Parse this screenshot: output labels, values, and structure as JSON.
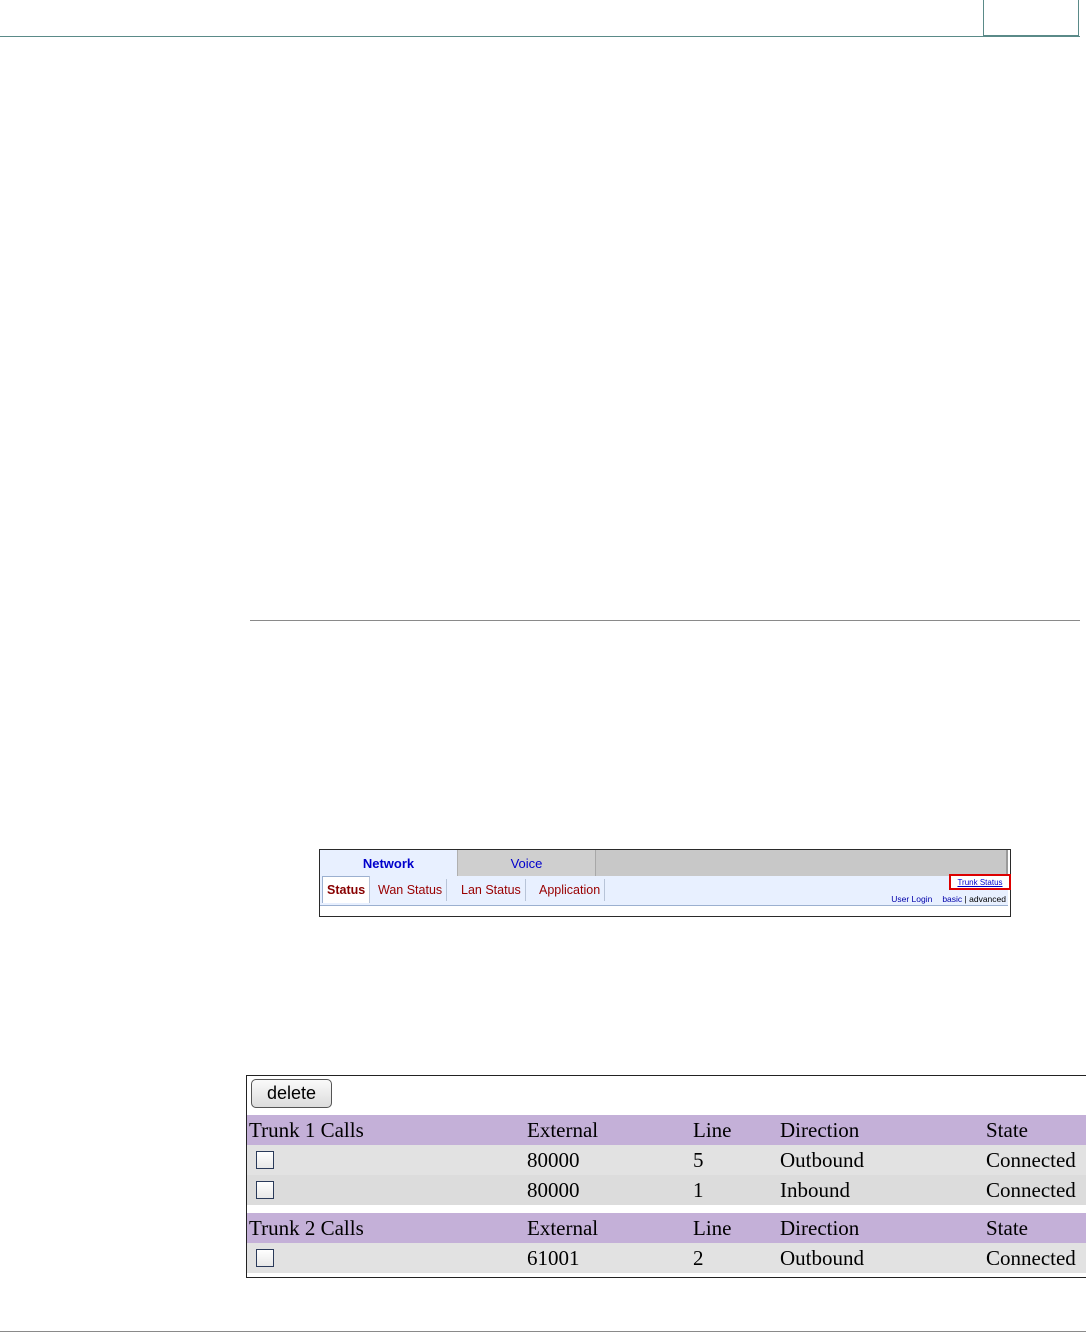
{
  "nav": {
    "tabs": [
      "Network",
      "Voice"
    ],
    "subtabs": [
      "Status",
      "Wan Status",
      "Lan Status",
      "Application"
    ],
    "trunk_status_link": "Trunk Status",
    "user_login": "User Login",
    "basic": "basic",
    "separator": "|",
    "advanced": "advanced"
  },
  "trunk_table": {
    "delete_label": "delete",
    "columns": [
      "External",
      "Line",
      "Direction",
      "State"
    ],
    "groups": [
      {
        "title": "Trunk 1 Calls",
        "rows": [
          {
            "external": "80000",
            "line": "5",
            "direction": "Outbound",
            "state": "Connected"
          },
          {
            "external": "80000",
            "line": "1",
            "direction": "Inbound",
            "state": "Connected"
          }
        ]
      },
      {
        "title": "Trunk 2 Calls",
        "rows": [
          {
            "external": "61001",
            "line": "2",
            "direction": "Outbound",
            "state": "Connected"
          }
        ]
      }
    ]
  }
}
